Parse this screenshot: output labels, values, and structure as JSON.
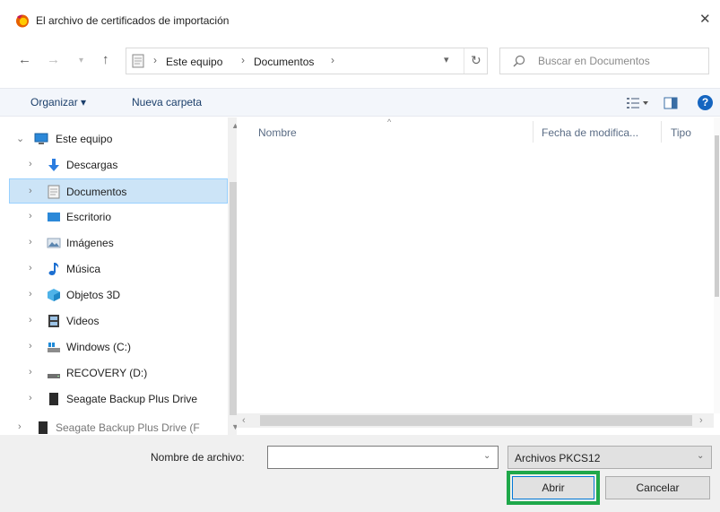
{
  "window": {
    "title": "El archivo de certificados de importación",
    "close_icon": "close-icon"
  },
  "navigation": {
    "back_icon": "arrow-left-icon",
    "forward_icon": "arrow-right-icon",
    "recent_icon": "chevron-down-icon",
    "up_icon": "arrow-up-icon",
    "breadcrumb": [
      "Este equipo",
      "Documentos"
    ],
    "refresh_icon": "refresh-icon"
  },
  "search": {
    "placeholder": "Buscar en Documentos"
  },
  "toolbar": {
    "organize_label": "Organizar ▾",
    "new_folder_label": "Nueva carpeta",
    "view_icon": "view-options-icon",
    "preview_icon": "preview-pane-icon",
    "help_label": "?"
  },
  "sidebar": {
    "items": [
      {
        "label": "Este equipo",
        "icon": "computer-icon",
        "chevron": "expanded",
        "selected": false
      },
      {
        "label": "Descargas",
        "icon": "download-icon",
        "chevron": "collapsed",
        "selected": false
      },
      {
        "label": "Documentos",
        "icon": "document-icon",
        "chevron": "collapsed",
        "selected": true
      },
      {
        "label": "Escritorio",
        "icon": "desktop-icon",
        "chevron": "collapsed",
        "selected": false
      },
      {
        "label": "Imágenes",
        "icon": "image-icon",
        "chevron": "collapsed",
        "selected": false
      },
      {
        "label": "Música",
        "icon": "music-icon",
        "chevron": "collapsed",
        "selected": false
      },
      {
        "label": "Objetos 3D",
        "icon": "3d-objects-icon",
        "chevron": "collapsed",
        "selected": false
      },
      {
        "label": "Videos",
        "icon": "video-icon",
        "chevron": "collapsed",
        "selected": false
      },
      {
        "label": "Windows (C:)",
        "icon": "drive-icon",
        "chevron": "collapsed",
        "selected": false
      },
      {
        "label": "RECOVERY (D:)",
        "icon": "drive-icon",
        "chevron": "collapsed",
        "selected": false
      },
      {
        "label": "Seagate Backup Plus Drive",
        "icon": "external-drive-icon",
        "chevron": "collapsed",
        "selected": false
      },
      {
        "label": "Seagate Backup Plus Drive (F",
        "icon": "external-drive-icon",
        "chevron": "collapsed",
        "selected": false
      }
    ]
  },
  "file_list": {
    "columns": [
      "Nombre",
      "Fecha de modifica...",
      "Tipo"
    ],
    "rows": []
  },
  "footer": {
    "filename_label": "Nombre de archivo:",
    "filename_value": "",
    "filter_value": "Archivos PKCS12",
    "open_label": "Abrir",
    "cancel_label": "Cancelar"
  },
  "colors": {
    "selection_bg": "#cce4f7",
    "highlight_border": "#1fa84a",
    "help_blue": "#1565c0",
    "toolbar_text": "#1b3f6b"
  }
}
